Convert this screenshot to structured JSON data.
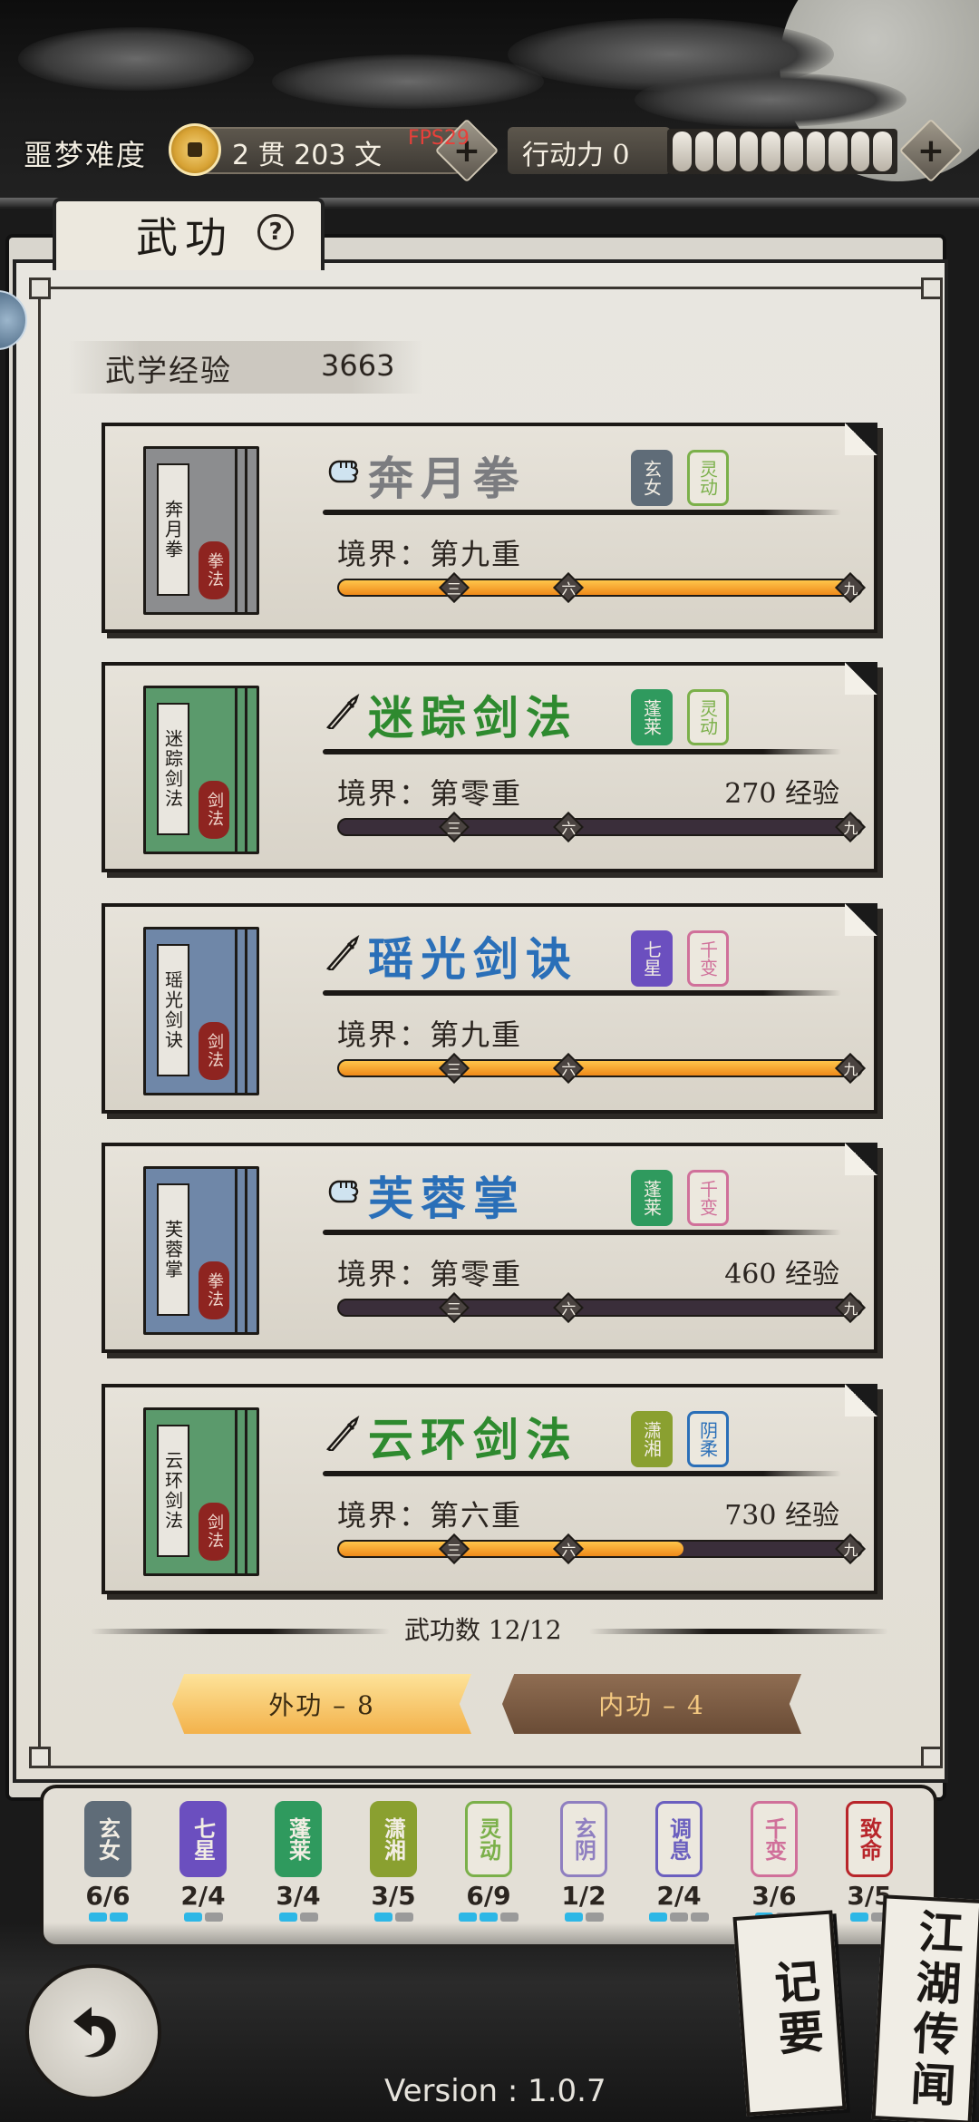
{
  "header": {
    "difficulty": "噩梦难度",
    "money": "2 贯  203 文",
    "fps": "FPS29",
    "action_label": "行动力 0",
    "plus": "+"
  },
  "panel": {
    "title": "武功",
    "help": "?",
    "exp_label": "武学经验",
    "exp_value": "3663"
  },
  "skills": [
    {
      "book_title": "奔月拳",
      "book_type": "拳法",
      "icon": "fist-icon",
      "name": "奔月拳",
      "name_color": "#7b7c80",
      "book_color": "#8c8d8f",
      "tags": [
        {
          "text": "玄女",
          "color": "#5f6c78"
        },
        {
          "text": "灵动",
          "color": "#7bb04a"
        }
      ],
      "realm": "境界：第九重",
      "exp_need": "",
      "progress": 1.0,
      "marks": [
        "三",
        "六",
        "九"
      ]
    },
    {
      "book_title": "迷踪剑法",
      "book_type": "剑法",
      "icon": "sword-icon",
      "name": "迷踪剑法",
      "name_color": "#2e8a2f",
      "book_color": "#5b9a6c",
      "tags": [
        {
          "text": "蓬莱",
          "color": "#2f9a5e"
        },
        {
          "text": "灵动",
          "color": "#7bb04a"
        }
      ],
      "realm": "境界：第零重",
      "exp_need": "270 经验",
      "progress": 0.0,
      "marks": [
        "三",
        "六",
        "九"
      ]
    },
    {
      "book_title": "瑶光剑诀",
      "book_type": "剑法",
      "icon": "sword-icon",
      "name": "瑶光剑诀",
      "name_color": "#2a6fb8",
      "book_color": "#6f87a8",
      "tags": [
        {
          "text": "七星",
          "color": "#6b4fbf"
        },
        {
          "text": "千变",
          "color": "#d0709a"
        }
      ],
      "realm": "境界：第九重",
      "exp_need": "",
      "progress": 1.0,
      "marks": [
        "三",
        "六",
        "九"
      ]
    },
    {
      "book_title": "芙蓉掌",
      "book_type": "拳法",
      "icon": "fist-icon",
      "name": "芙蓉掌",
      "name_color": "#2a6fb8",
      "book_color": "#6f87a8",
      "tags": [
        {
          "text": "蓬莱",
          "color": "#2f9a5e"
        },
        {
          "text": "千变",
          "color": "#d0709a"
        }
      ],
      "realm": "境界：第零重",
      "exp_need": "460 经验",
      "progress": 0.0,
      "marks": [
        "三",
        "六",
        "九"
      ]
    },
    {
      "book_title": "云环剑法",
      "book_type": "剑法",
      "icon": "sword-icon",
      "name": "云环剑法",
      "name_color": "#2e8a2f",
      "book_color": "#5b9a6c",
      "tags": [
        {
          "text": "潇湘",
          "color": "#8aa030"
        },
        {
          "text": "阴柔",
          "color": "#2a6fb8"
        }
      ],
      "realm": "境界：第六重",
      "exp_need": "730 经验",
      "progress": 0.66,
      "marks": [
        "三",
        "六",
        "九"
      ]
    }
  ],
  "count": "武功数 12/12",
  "tabs": {
    "outer": "外功 – 8",
    "inner": "内功 – 4"
  },
  "traits": [
    {
      "text": "玄女",
      "value": "6/6",
      "color": "#5f6c78",
      "filled": true,
      "dots": [
        1,
        1
      ]
    },
    {
      "text": "七星",
      "value": "2/4",
      "color": "#6b4fbf",
      "filled": true,
      "dots": [
        1,
        0
      ]
    },
    {
      "text": "蓬莱",
      "value": "3/4",
      "color": "#2f9a5e",
      "filled": true,
      "dots": [
        1,
        0
      ]
    },
    {
      "text": "潇湘",
      "value": "3/5",
      "color": "#8aa030",
      "filled": true,
      "dots": [
        1,
        0
      ]
    },
    {
      "text": "灵动",
      "value": "6/9",
      "color": "#7bb04a",
      "filled": false,
      "dots": [
        1,
        1,
        0
      ]
    },
    {
      "text": "玄阴",
      "value": "1/2",
      "color": "#8f7fc0",
      "filled": false,
      "dots": [
        1,
        0
      ]
    },
    {
      "text": "调息",
      "value": "2/4",
      "color": "#6b5fbf",
      "filled": false,
      "dots": [
        1,
        0,
        0
      ]
    },
    {
      "text": "千变",
      "value": "3/6",
      "color": "#d0709a",
      "filled": false,
      "dots": [
        1,
        0
      ]
    },
    {
      "text": "致命",
      "value": "3/5",
      "color": "#b8252a",
      "filled": false,
      "dots": [
        1,
        0
      ]
    }
  ],
  "footer": {
    "version": "Version : 1.0.7",
    "notes": "记要",
    "rumors": "江湖传闻"
  }
}
